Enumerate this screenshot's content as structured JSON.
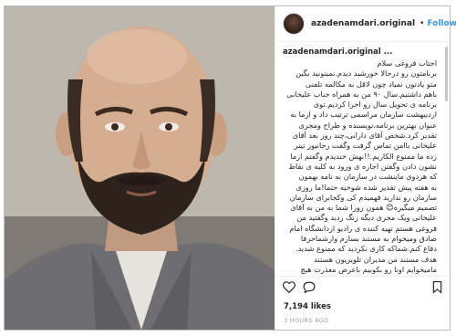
{
  "post": {
    "username": "azadenamdari.original",
    "follow_label": "Follow",
    "dot": "•",
    "likes": "7,194 likes",
    "time": "3 HOURS AGO"
  },
  "caption": {
    "user": "azadenamdari.original ...",
    "lines": [
      "اجتاب فروغی سلام",
      "برنامتون رو درجالا خورشید دیدم.نمیتونید بگین",
      "متو یادتون نمیاد چون لاقل به مکالمه تلفنی",
      "باهم داشتیم.سال ۹۰ من به همراه جناب علیخانی",
      "برنامه ی تحویل سال رو اجرا کردیم.توی",
      "اردیبهشت سازمان مراسمی ترتیب داد و ازما به",
      "عنوان بهترین برنامه،نویسنده و طراح ومجری",
      "تقدیر کرد.شخص آقای دارابی،چند روز بعد آقای",
      "علیخانی باامن تماس گرفت وگفت رحانیوز تیتر",
      "زده ما ممنوع الکاریم.!!بهش خندیدم وگفتم ازما",
      "نشون دادن وگفتن اجازه ی ورود به کلیه ی نقاط",
      "که هردوی ماینشت در سازمان به نامه بهمون",
      "به هفته پیش تقدیر شده شوخیه حتما!ما روزی",
      "سازمان رو ندارید فهمیدم کی وکجابرای سازمان",
      "تصمیم میگیره😊 همون روزا شما به من به آقای",
      "علیخانی ویک مجری دیگه زنگ زدید وگفتید من",
      "فروغی هستم تهیه کننده ی رادیو ازدانشگاه امام",
      "صادق ومیخوام به مستند بسازم وازشماحرفا",
      "دفاع کنم.شماکه کاری نکردید که ممنوع شدید.",
      "هدف مستند من مدیران تلویزیون هستند",
      "مامیخوایم اونا رو بکوبیم باعرض معذرت هیچ",
      "کدوممون شما رو تحویل نگرفتیم وگفتیم ما به"
    ]
  },
  "icons": {
    "verified": "verified-badge-icon",
    "heart": "heart-icon",
    "comment": "comment-icon",
    "bookmark": "bookmark-icon",
    "avatar": "profile-avatar"
  },
  "colors": {
    "accent": "#3897f0",
    "text": "#262626",
    "muted": "#999999",
    "border": "#efefef"
  }
}
